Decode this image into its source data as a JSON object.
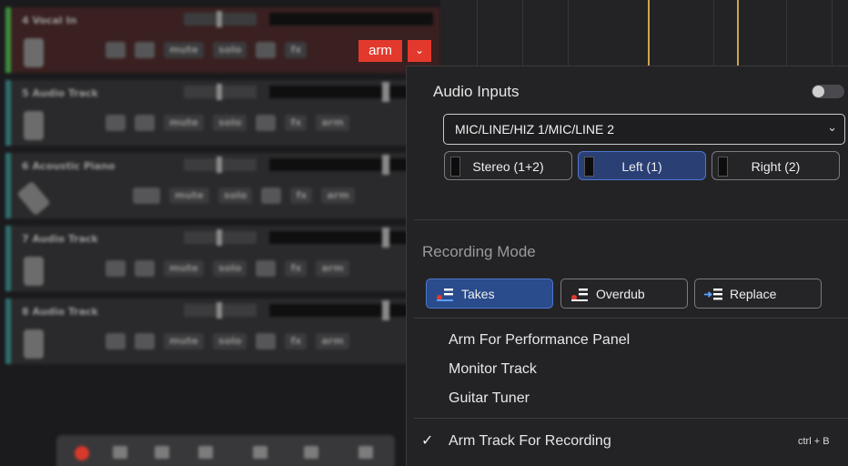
{
  "tracks": [
    {
      "name": "4  Vocal In",
      "state": "armed"
    },
    {
      "name": "5  Audio Track"
    },
    {
      "name": "6  Acoustic Piano"
    },
    {
      "name": "7  Audio Track"
    },
    {
      "name": "8  Audio Track"
    }
  ],
  "track_buttons": {
    "mute": "mute",
    "solo": "solo",
    "fx": "fx",
    "arm": "arm"
  },
  "arm_button": {
    "label": "arm",
    "color": "#e3392c"
  },
  "popup": {
    "audio_inputs": {
      "title": "Audio Inputs",
      "toggle_on": false,
      "selected_input": "MIC/LINE/HIZ 1/MIC/LINE 2",
      "channels": [
        {
          "label": "Stereo (1+2)",
          "selected": false
        },
        {
          "label": "Left (1)",
          "selected": true
        },
        {
          "label": "Right (2)",
          "selected": false
        }
      ]
    },
    "recording_mode": {
      "title": "Recording Mode",
      "modes": [
        {
          "label": "Takes",
          "icon": "takes-icon",
          "selected": true
        },
        {
          "label": "Overdub",
          "icon": "overdub-icon",
          "selected": false
        },
        {
          "label": "Replace",
          "icon": "replace-icon",
          "selected": false
        }
      ]
    },
    "menu_items": [
      "Arm For Performance Panel",
      "Monitor Track",
      "Guitar Tuner"
    ],
    "arm_track": {
      "label": "Arm Track For Recording",
      "checked": true,
      "check": "✓",
      "shortcut": "ctrl + B"
    }
  },
  "colors": {
    "accent_blue": "#2a4b8c",
    "arm_red": "#e3392c",
    "record_red": "#d8392b"
  }
}
